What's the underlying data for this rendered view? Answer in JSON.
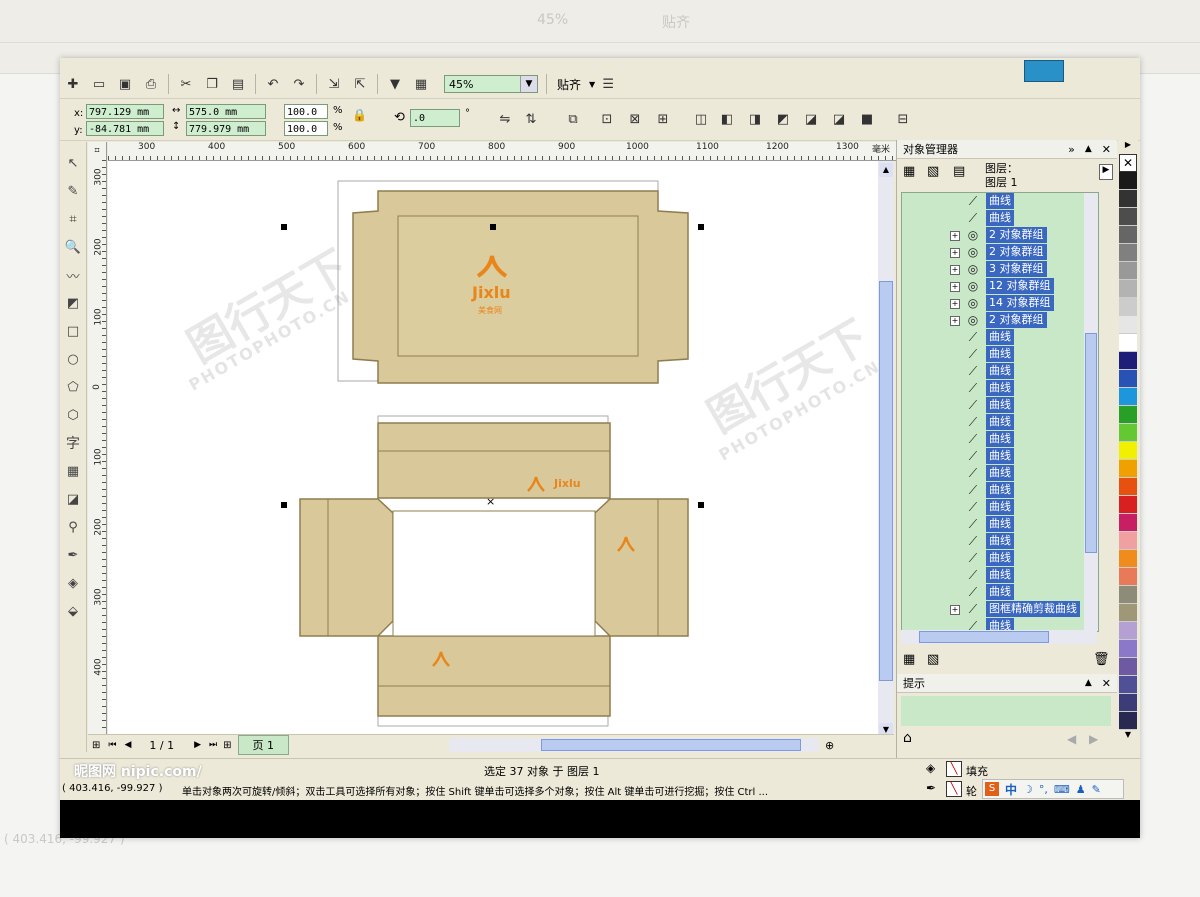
{
  "app": {
    "zoom": "45%",
    "snap_label": "贴齐",
    "page_name": "页 1"
  },
  "property_bar": {
    "x_label": "x:",
    "y_label": "y:",
    "x_value": "797.129 mm",
    "y_value": "-84.781 mm",
    "width_value": "575.0 mm",
    "height_value": "779.979 mm",
    "scale_x": "100.0",
    "scale_y": "100.0",
    "percent": "%",
    "rotation": ".0",
    "degree": "°"
  },
  "ruler": {
    "h_ticks": [
      "300",
      "400",
      "500",
      "600",
      "700",
      "800",
      "900",
      "1000",
      "1100",
      "1200",
      "1300"
    ],
    "h_unit": "毫米",
    "v_ticks": [
      "300",
      "200",
      "100",
      "0",
      "100",
      "200",
      "300",
      "400"
    ]
  },
  "navigator": {
    "page_count": "1 / 1",
    "page_tab": "页 1"
  },
  "object_manager": {
    "title": "对象管理器",
    "layer_label": "图层：",
    "layer_name": "图层 1",
    "items": [
      {
        "label": "曲线",
        "group": false
      },
      {
        "label": "曲线",
        "group": false
      },
      {
        "label": "2 对象群组",
        "group": true
      },
      {
        "label": "2 对象群组",
        "group": true
      },
      {
        "label": "3 对象群组",
        "group": true
      },
      {
        "label": "12 对象群组",
        "group": true
      },
      {
        "label": "14 对象群组",
        "group": true
      },
      {
        "label": "2 对象群组",
        "group": true
      },
      {
        "label": "曲线",
        "group": false
      },
      {
        "label": "曲线",
        "group": false
      },
      {
        "label": "曲线",
        "group": false
      },
      {
        "label": "曲线",
        "group": false
      },
      {
        "label": "曲线",
        "group": false
      },
      {
        "label": "曲线",
        "group": false
      },
      {
        "label": "曲线",
        "group": false
      },
      {
        "label": "曲线",
        "group": false
      },
      {
        "label": "曲线",
        "group": false
      },
      {
        "label": "曲线",
        "group": false
      },
      {
        "label": "曲线",
        "group": false
      },
      {
        "label": "曲线",
        "group": false
      },
      {
        "label": "曲线",
        "group": false
      },
      {
        "label": "曲线",
        "group": false
      },
      {
        "label": "曲线",
        "group": false
      },
      {
        "label": "曲线",
        "group": false
      },
      {
        "label": "图框精确剪裁曲线",
        "group": true
      },
      {
        "label": "曲线",
        "group": false
      }
    ]
  },
  "hints": {
    "title": "提示"
  },
  "status": {
    "selection": "选定 37 对象 于 图层 1",
    "coords": "( 403.416, -99.927 )",
    "message": "单击对象两次可旋转/倾斜；双击工具可选择所有对象；按住 Shift 键单击可选择多个对象；按住 Alt 键单击可进行挖掘；按住 Ctrl ...",
    "fill_label": "填充",
    "outline_label": "轮",
    "ime": "中"
  },
  "watermarks": {
    "brand_cn": "图行天下",
    "brand_en": "PHOTOPHOTO.CN",
    "nipic": "昵图网 nipic.com/"
  },
  "artwork": {
    "logo_text": "Jixlu",
    "logo_sub": "美食网"
  },
  "colors": {
    "box_fill": "#d9c99a",
    "box_dark": "#c8b47e",
    "box_stroke": "#8f7d4f",
    "logo_orange": "#e8861c",
    "selection_blue": "#3a67c0",
    "tree_bg": "#c8e8c8"
  },
  "palette": [
    "#1a1a1a",
    "#333333",
    "#4d4d4d",
    "#666666",
    "#808080",
    "#999999",
    "#b3b3b3",
    "#cccccc",
    "#e6e6e6",
    "#ffffff",
    "#1e1e78",
    "#2852b4",
    "#1e96dc",
    "#28a028",
    "#64c832",
    "#f0f000",
    "#f0a000",
    "#e85010",
    "#d82020",
    "#c81e64",
    "#f0a0a0",
    "#f08c1e",
    "#e87a5a",
    "#8c8c78",
    "#a09678",
    "#b4a0d2",
    "#8c78c8",
    "#6e5aa0",
    "#505096",
    "#3c3c78",
    "#282850"
  ]
}
